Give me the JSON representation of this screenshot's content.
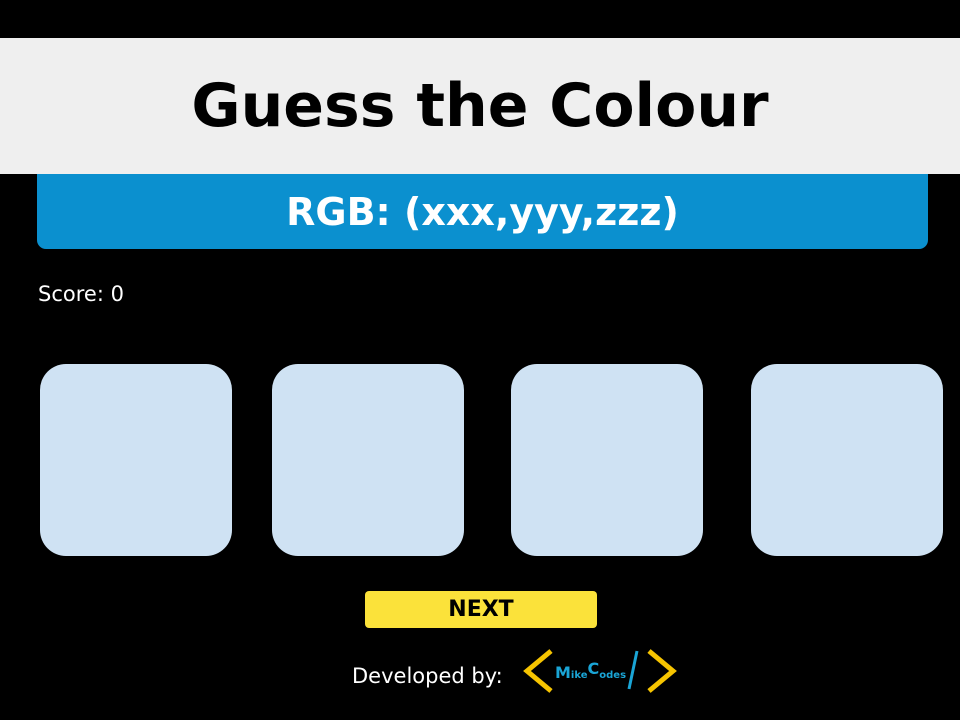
{
  "header": {
    "title": "Guess the Colour"
  },
  "rgb_display": {
    "text": "RGB: (xxx,yyy,zzz)"
  },
  "score": {
    "text": "Score: 0",
    "value": 0
  },
  "tiles": [
    {
      "color": "#cfe2f3"
    },
    {
      "color": "#cfe2f3"
    },
    {
      "color": "#cfe2f3"
    },
    {
      "color": "#cfe2f3"
    }
  ],
  "next_button": {
    "label": "NEXT"
  },
  "footer": {
    "developed_by": "Developed by:",
    "logo": {
      "part1": "M",
      "part2": "ike",
      "part3": "C",
      "part4": "odes",
      "bracket_color": "#f6c400",
      "slash_color": "#1aa5d6",
      "text_color": "#1aa5d6"
    }
  },
  "colors": {
    "background": "#000000",
    "title_bar": "#efefef",
    "rgb_bar": "#0b90cf",
    "next_button": "#fbe23a"
  }
}
